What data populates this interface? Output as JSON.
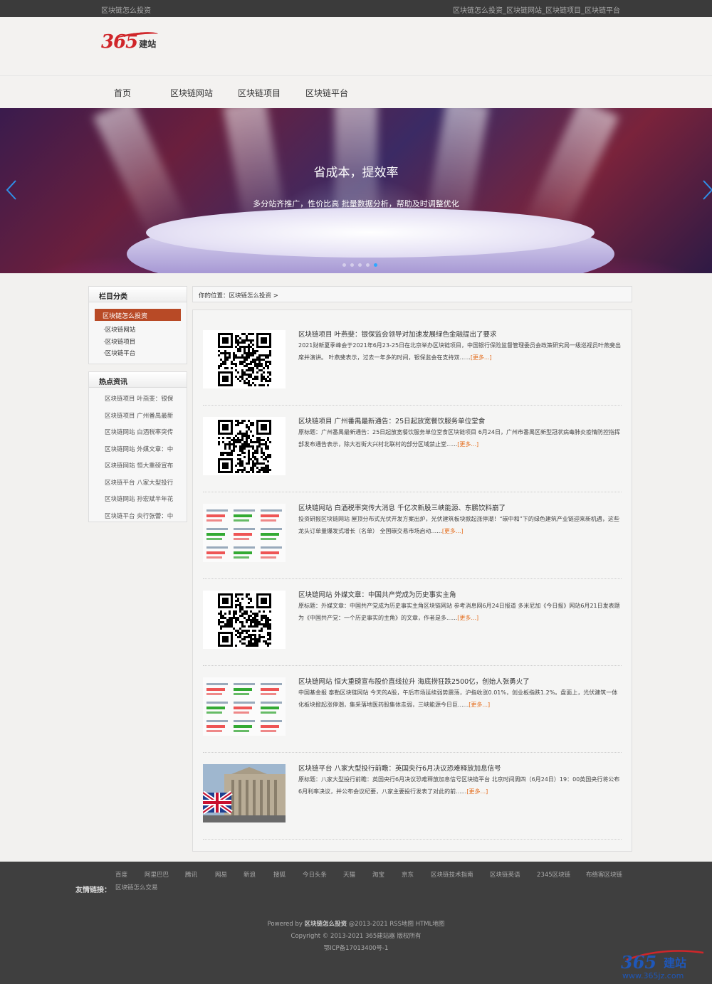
{
  "topbar": {
    "left": "区块链怎么投资",
    "right": "区块链怎么投资_区块链网站_区块链项目_区块链平台"
  },
  "logo": {
    "number": "365",
    "text": "建站"
  },
  "nav": [
    "首页",
    "区块链网站",
    "区块链项目",
    "区块链平台"
  ],
  "banner": {
    "title": "省成本，提效率",
    "subtitle": "多分站齐推广，性价比高 批量数据分析，帮助及时调整优化",
    "slides": 5,
    "active_slide": 5
  },
  "sidebar": {
    "category_title": "栏目分类",
    "active_category": "区块链怎么投资",
    "sub_categories": [
      "·区块链网站",
      "·区块链项目",
      "·区块链平台"
    ],
    "hot_title": "热点资讯",
    "hot_items": [
      "区块链项目 叶燕斐：银保",
      "区块链项目 广州番禺最新",
      "区块链网站 白酒税率突传",
      "区块链网站 外媒文章：中",
      "区块链网站 恒大重磅宣布",
      "区块链平台 八家大型投行",
      "区块链网站 孙宏斌半年花",
      "区块链平台 央行张蕾：中"
    ]
  },
  "breadcrumb": "你的位置：区块链怎么投资 >",
  "posts": [
    {
      "title": "区块链项目 叶燕斐：银保监会领导对加速发展绿色金融提出了要求",
      "desc": "2021财新夏季峰会于2021年6月23-25日在北京举办区块链项目，中国银行保险监督管理委员会政策研究局一级巡视员叶燕斐出席并演讲。 叶燕斐表示，过去一年多的时间，银保监会在支持双......",
      "more": "[更多...]",
      "thumb": "qr"
    },
    {
      "title": "区块链项目 广州番禺最新通告：25日起放宽餐饮服务单位堂食",
      "desc": "原标题：广州番禺最新通告：25日起放宽餐饮服务单位堂食区块链项目 6月24日，广州市番禺区新型冠状病毒肺炎疫情防控指挥部发布通告表示，除大石街大兴村北联村的部分区域禁止堂......",
      "more": "[更多...]",
      "thumb": "qr"
    },
    {
      "title": "区块链网站 白酒税率突传大消息 千亿次新股三峡能源、东鹏饮料崩了",
      "desc": "投资研报区块链网站 屋顶分布式光伏开发方案出炉，光伏建筑板块掀起涨停潮！“碳中和”下的绿色建筑产业链迎来新机遇，这些龙头订单量爆发式增长（名单） 全国碳交易市场启动......",
      "more": "[更多...]",
      "thumb": "stock"
    },
    {
      "title": "区块链网站 外媒文章：中国共产党成为历史事实主角",
      "desc": "原标题：外媒文章：中国共产党成为历史事实主角区块链网站 参考消息网6月24日报道 多米尼加《今日报》网站6月21日发表题为《中国共产党：一个历史事实的主角》的文章，作者是多......",
      "more": "[更多...]",
      "thumb": "qr"
    },
    {
      "title": "区块链网站 恒大重磅宣布股价直线拉升 海底捞狂跌2500亿，创始人张勇火了",
      "desc": "中国基金报 泰勒区块链网站 今天的A股，午后市场延续弱势震荡，沪指收涨0.01%，创业板指跌1.2%。盘面上，光伏建筑一体化板块掀起涨停潮，集采落地医药股集体走弱，三峡能源今日巨......",
      "more": "[更多...]",
      "thumb": "stock"
    },
    {
      "title": "区块链平台 八家大型投行前瞻：英国央行6月决议恐难释放加息信号",
      "desc": "原标题：八家大型投行前瞻：英国央行6月决议恐难释放加息信号区块链平台 北京时间周四（6月24日）19：00英国央行将公布6月利率决议，并公布会议纪要，八家主要投行发表了对此的前......",
      "more": "[更多...]",
      "thumb": "photo"
    }
  ],
  "footer": {
    "links": [
      "百度",
      "阿里巴巴",
      "腾讯",
      "网易",
      "新浪",
      "搜狐",
      "今日头条",
      "天猫",
      "淘宝",
      "京东",
      "区块链技术指南",
      "区块链英语",
      "2345区块链",
      "布络客区块链"
    ],
    "friend_label": "友情链接：",
    "friend_link": "区块链怎么交易",
    "powered_prefix": "Powered by ",
    "powered_site": "区块链怎么投资",
    "powered_suffix": " @2013-2021 RSS地图 HTML地图",
    "copyright": "Copyright © 2013-2021 365建站器 版权所有",
    "icp": "鄂ICP备17013400号-1"
  },
  "watermark": {
    "number": "365",
    "text": "建站",
    "url": "www.365jz.com"
  }
}
